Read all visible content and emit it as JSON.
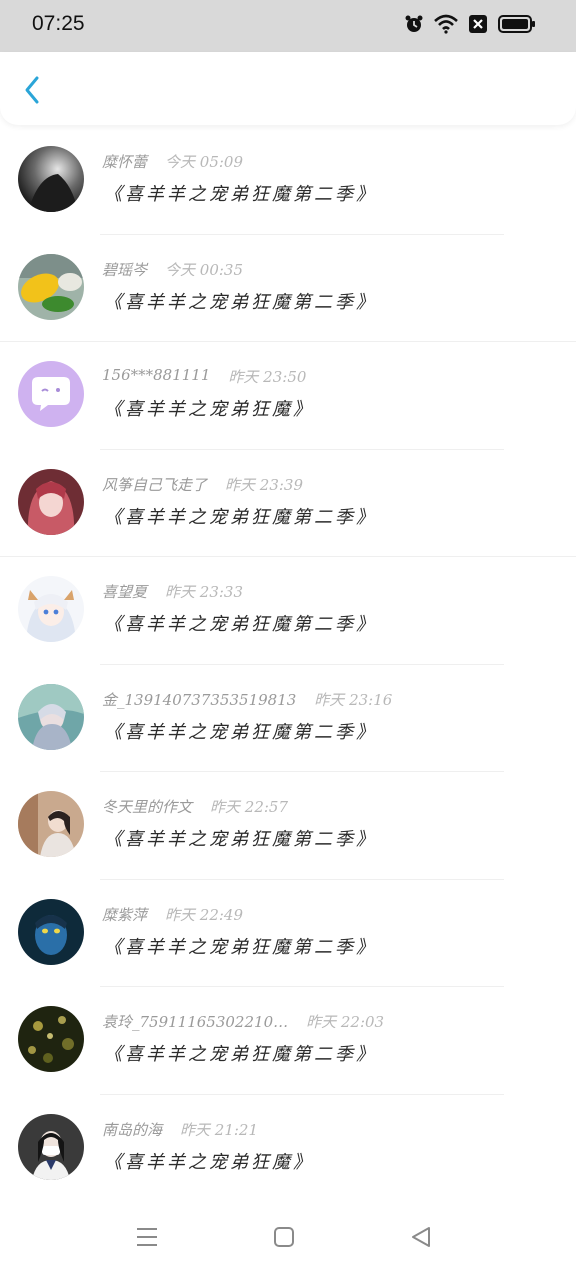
{
  "status_bar": {
    "time": "07:25",
    "icons": [
      "alarm-icon",
      "wifi-icon",
      "sim-disabled-icon",
      "battery-icon"
    ]
  },
  "header": {
    "back_icon": "chevron-left-icon",
    "accent": "#2aa5d8"
  },
  "comments": [
    {
      "name": "糜怀蕾",
      "time": "今天 05:09",
      "message": "《喜羊羊之宠弟狂魔第二季》",
      "avatar": "gray-bw"
    },
    {
      "name": "碧瑶岑",
      "time": "今天 00:35",
      "message": "《喜羊羊之宠弟狂魔第二季》",
      "avatar": "corn"
    },
    {
      "name": "156***881111",
      "time": "昨天 23:50",
      "message": "《喜羊羊之宠弟狂魔》",
      "avatar": "default-purple"
    },
    {
      "name": "风筝自己飞走了",
      "time": "昨天 23:39",
      "message": "《喜羊羊之宠弟狂魔第二季》",
      "avatar": "pink-anime"
    },
    {
      "name": "喜望夏",
      "time": "昨天 23:33",
      "message": "《喜羊羊之宠弟狂魔第二季》",
      "avatar": "white-anime"
    },
    {
      "name": "金_139140737353519813",
      "time": "昨天 23:16",
      "message": "《喜羊羊之宠弟狂魔第二季》",
      "avatar": "teal-anime"
    },
    {
      "name": "冬天里的作文",
      "time": "昨天 22:57",
      "message": "《喜羊羊之宠弟狂魔第二季》",
      "avatar": "girl-photo"
    },
    {
      "name": "糜紫萍",
      "time": "昨天 22:49",
      "message": "《喜羊羊之宠弟狂魔第二季》",
      "avatar": "navi"
    },
    {
      "name": "袁玲_75911165302210…",
      "time": "昨天 22:03",
      "message": "《喜羊羊之宠弟狂魔第二季》",
      "avatar": "night-bokeh"
    },
    {
      "name": "南岛的海",
      "time": "昨天 21:21",
      "message": "《喜羊羊之宠弟狂魔》",
      "avatar": "mask-girl"
    }
  ],
  "nav_bar": {
    "icons": [
      "menu-icon",
      "home-icon",
      "back-triangle-icon"
    ]
  }
}
